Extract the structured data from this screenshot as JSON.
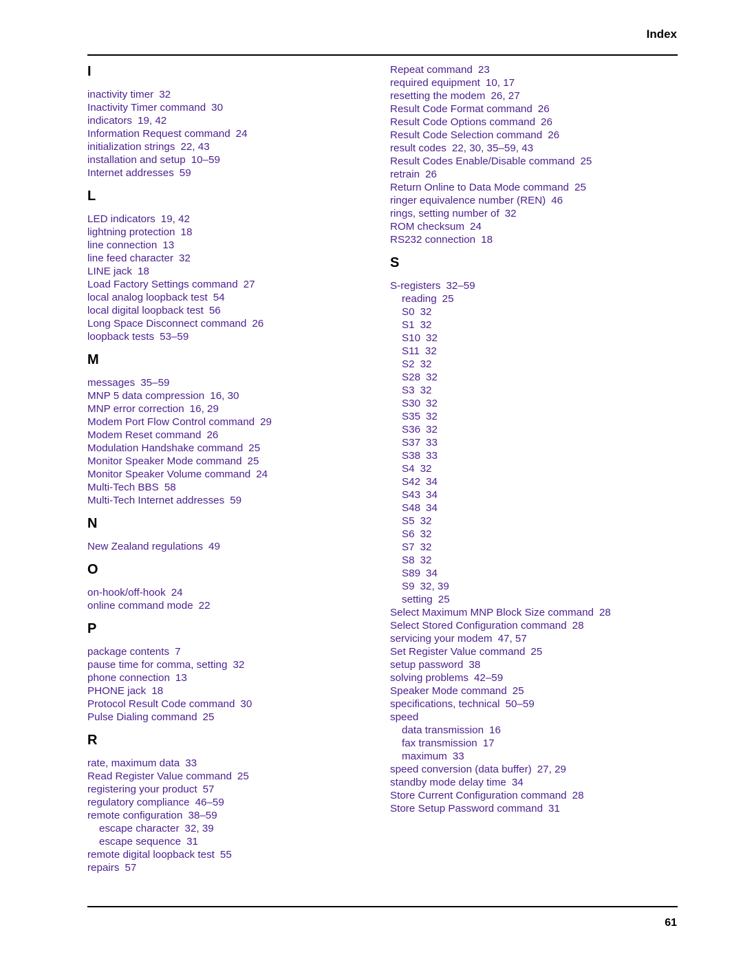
{
  "header": {
    "title": "Index"
  },
  "footer": {
    "page_number": "61"
  },
  "colors": {
    "entry_text": "#4b1f8f",
    "heading_text": "#000000"
  },
  "left_column": [
    {
      "letter": "I",
      "entries": [
        {
          "term": "inactivity timer",
          "pages": "32"
        },
        {
          "term": "Inactivity Timer command",
          "pages": "30"
        },
        {
          "term": "indicators",
          "pages": "19,  42"
        },
        {
          "term": "Information Request command",
          "pages": "24"
        },
        {
          "term": "initialization strings",
          "pages": "22,  43"
        },
        {
          "term": "installation and setup",
          "pages": "10–59"
        },
        {
          "term": "Internet addresses",
          "pages": "59"
        }
      ]
    },
    {
      "letter": "L",
      "entries": [
        {
          "term": "LED indicators",
          "pages": "19,  42"
        },
        {
          "term": "lightning protection",
          "pages": "18"
        },
        {
          "term": "line connection",
          "pages": "13"
        },
        {
          "term": "line feed character",
          "pages": "32"
        },
        {
          "term": "LINE jack",
          "pages": "18"
        },
        {
          "term": "Load Factory Settings command",
          "pages": "27"
        },
        {
          "term": "local analog loopback test",
          "pages": "54"
        },
        {
          "term": "local digital loopback test",
          "pages": "56"
        },
        {
          "term": "Long Space Disconnect command",
          "pages": "26"
        },
        {
          "term": "loopback tests",
          "pages": "53–59"
        }
      ]
    },
    {
      "letter": "M",
      "entries": [
        {
          "term": "messages",
          "pages": "35–59"
        },
        {
          "term": "MNP 5 data compression",
          "pages": "16,  30"
        },
        {
          "term": "MNP error correction",
          "pages": "16,  29"
        },
        {
          "term": "Modem Port Flow Control command",
          "pages": "29"
        },
        {
          "term": "Modem Reset command",
          "pages": "26"
        },
        {
          "term": "Modulation Handshake command",
          "pages": "25"
        },
        {
          "term": "Monitor Speaker Mode command",
          "pages": "25"
        },
        {
          "term": "Monitor Speaker Volume command",
          "pages": "24"
        },
        {
          "term": "Multi-Tech BBS",
          "pages": "58"
        },
        {
          "term": "Multi-Tech Internet addresses",
          "pages": "59"
        }
      ]
    },
    {
      "letter": "N",
      "entries": [
        {
          "term": "New Zealand regulations",
          "pages": "49"
        }
      ]
    },
    {
      "letter": "O",
      "entries": [
        {
          "term": "on-hook/off-hook",
          "pages": "24"
        },
        {
          "term": "online command mode",
          "pages": "22"
        }
      ]
    },
    {
      "letter": "P",
      "entries": [
        {
          "term": "package contents",
          "pages": "7"
        },
        {
          "term": "pause time for comma, setting",
          "pages": "32"
        },
        {
          "term": "phone connection",
          "pages": "13"
        },
        {
          "term": "PHONE jack",
          "pages": "18"
        },
        {
          "term": "Protocol Result Code command",
          "pages": "30"
        },
        {
          "term": "Pulse Dialing command",
          "pages": "25"
        }
      ]
    },
    {
      "letter": "R",
      "entries": [
        {
          "term": "rate, maximum data",
          "pages": "33"
        },
        {
          "term": "Read Register Value command",
          "pages": "25"
        },
        {
          "term": "registering your product",
          "pages": "57"
        },
        {
          "term": "regulatory compliance",
          "pages": "46–59"
        },
        {
          "term": "remote configuration",
          "pages": "38–59"
        },
        {
          "term": "escape character",
          "pages": "32,  39",
          "sub": true
        },
        {
          "term": "escape sequence",
          "pages": "31",
          "sub": true
        },
        {
          "term": "remote digital loopback test",
          "pages": "55"
        },
        {
          "term": "repairs",
          "pages": "57"
        }
      ]
    }
  ],
  "right_column": [
    {
      "letter": null,
      "entries": [
        {
          "term": "Repeat command",
          "pages": "23"
        },
        {
          "term": "required equipment",
          "pages": "10,  17"
        },
        {
          "term": "resetting the modem",
          "pages": "26,  27"
        },
        {
          "term": "Result Code Format command",
          "pages": "26"
        },
        {
          "term": "Result Code Options command",
          "pages": "26"
        },
        {
          "term": "Result Code Selection command",
          "pages": "26"
        },
        {
          "term": "result codes",
          "pages": "22,  30,  35–59,  43"
        },
        {
          "term": "Result Codes Enable/Disable command",
          "pages": "25"
        },
        {
          "term": "retrain",
          "pages": "26"
        },
        {
          "term": "Return Online to Data Mode command",
          "pages": "25"
        },
        {
          "term": "ringer equivalence number (REN)",
          "pages": "46"
        },
        {
          "term": "rings, setting number of",
          "pages": "32"
        },
        {
          "term": "ROM checksum",
          "pages": "24"
        },
        {
          "term": "RS232 connection",
          "pages": "18"
        }
      ]
    },
    {
      "letter": "S",
      "entries": [
        {
          "term": "S-registers",
          "pages": "32–59"
        },
        {
          "term": "reading",
          "pages": "25",
          "sub": true
        },
        {
          "term": "S0",
          "pages": "32",
          "sub": true
        },
        {
          "term": "S1",
          "pages": "32",
          "sub": true
        },
        {
          "term": "S10",
          "pages": "32",
          "sub": true
        },
        {
          "term": "S11",
          "pages": "32",
          "sub": true
        },
        {
          "term": "S2",
          "pages": "32",
          "sub": true
        },
        {
          "term": "S28",
          "pages": "32",
          "sub": true
        },
        {
          "term": "S3",
          "pages": "32",
          "sub": true
        },
        {
          "term": "S30",
          "pages": "32",
          "sub": true
        },
        {
          "term": "S35",
          "pages": "32",
          "sub": true
        },
        {
          "term": "S36",
          "pages": "32",
          "sub": true
        },
        {
          "term": "S37",
          "pages": "33",
          "sub": true
        },
        {
          "term": "S38",
          "pages": "33",
          "sub": true
        },
        {
          "term": "S4",
          "pages": "32",
          "sub": true
        },
        {
          "term": "S42",
          "pages": "34",
          "sub": true
        },
        {
          "term": "S43",
          "pages": "34",
          "sub": true
        },
        {
          "term": "S48",
          "pages": "34",
          "sub": true
        },
        {
          "term": "S5",
          "pages": "32",
          "sub": true
        },
        {
          "term": "S6",
          "pages": "32",
          "sub": true
        },
        {
          "term": "S7",
          "pages": "32",
          "sub": true
        },
        {
          "term": "S8",
          "pages": "32",
          "sub": true
        },
        {
          "term": "S89",
          "pages": "34",
          "sub": true
        },
        {
          "term": "S9",
          "pages": "32,  39",
          "sub": true
        },
        {
          "term": "setting",
          "pages": "25",
          "sub": true
        },
        {
          "term": "Select Maximum MNP Block Size command",
          "pages": "28"
        },
        {
          "term": "Select Stored Configuration command",
          "pages": "28"
        },
        {
          "term": "servicing your modem",
          "pages": "47,  57"
        },
        {
          "term": "Set Register Value command",
          "pages": "25"
        },
        {
          "term": "setup password",
          "pages": "38"
        },
        {
          "term": "solving problems",
          "pages": "42–59"
        },
        {
          "term": "Speaker Mode command",
          "pages": "25"
        },
        {
          "term": "specifications, technical",
          "pages": "50–59"
        },
        {
          "term": "speed",
          "pages": ""
        },
        {
          "term": "data transmission",
          "pages": "16",
          "sub": true
        },
        {
          "term": "fax transmission",
          "pages": "17",
          "sub": true
        },
        {
          "term": "maximum",
          "pages": "33",
          "sub": true
        },
        {
          "term": "speed conversion (data buffer)",
          "pages": "27,  29"
        },
        {
          "term": "standby mode delay time",
          "pages": "34"
        },
        {
          "term": "Store Current Configuration command",
          "pages": "28"
        },
        {
          "term": "Store Setup Password command",
          "pages": "31"
        }
      ]
    }
  ]
}
